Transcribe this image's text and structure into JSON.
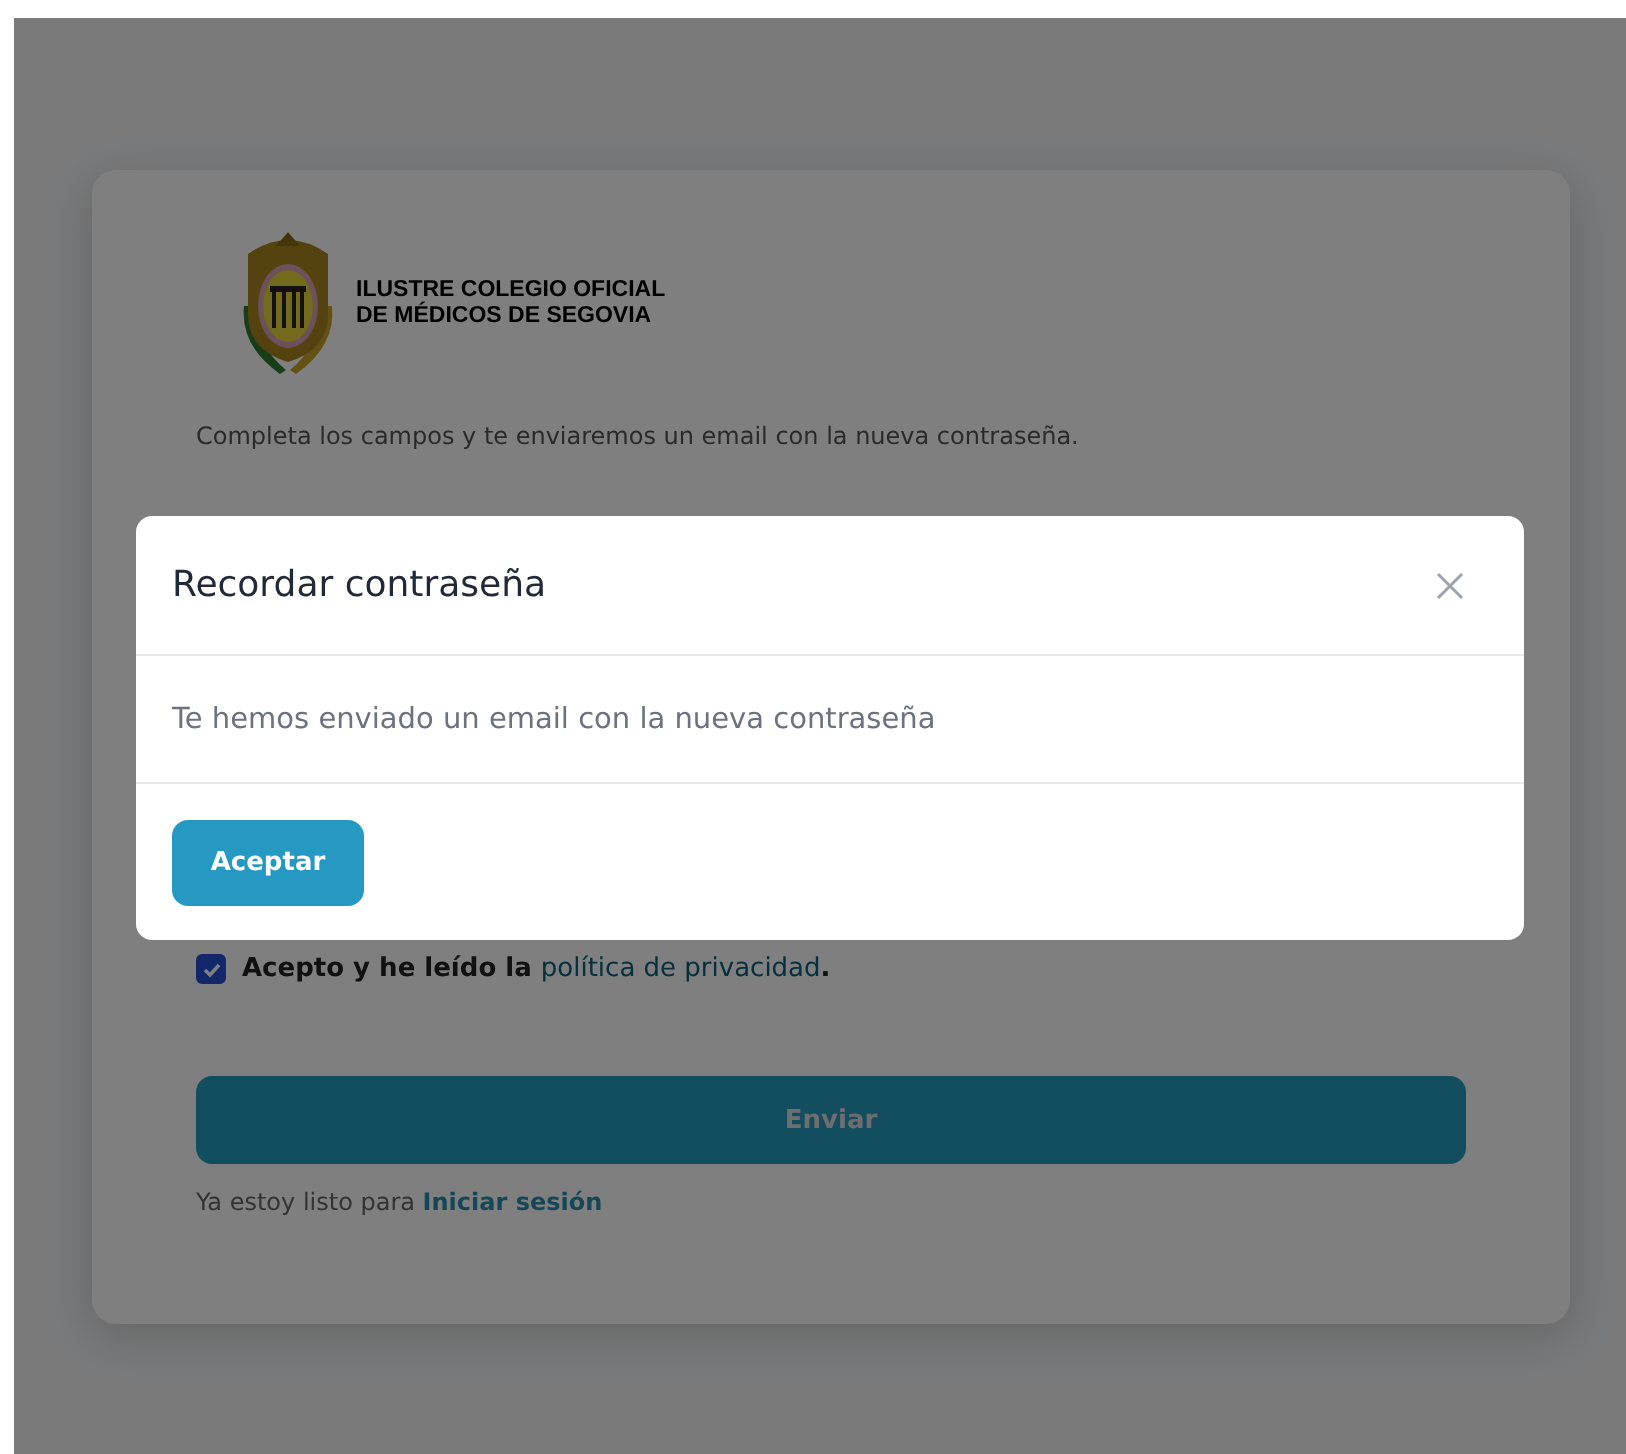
{
  "brand": {
    "lines": [
      "ILUSTRE COLEGIO OFICIAL",
      "DE MÉDICOS DE SEGOVIA"
    ]
  },
  "description": "Completa los campos y te enviaremos un email con la nueva contraseña.",
  "privacy": {
    "checked": true,
    "text": "Acepto y he leído la ",
    "link": "política de privacidad",
    "after": "."
  },
  "submit": {
    "label": "Enviar"
  },
  "login": {
    "text": "Ya estoy listo para ",
    "link": "Iniciar sesión"
  },
  "modal": {
    "title": "Recordar contraseña",
    "message": "Te hemos enviado un email con la nueva contraseña",
    "button": "Aceptar"
  }
}
